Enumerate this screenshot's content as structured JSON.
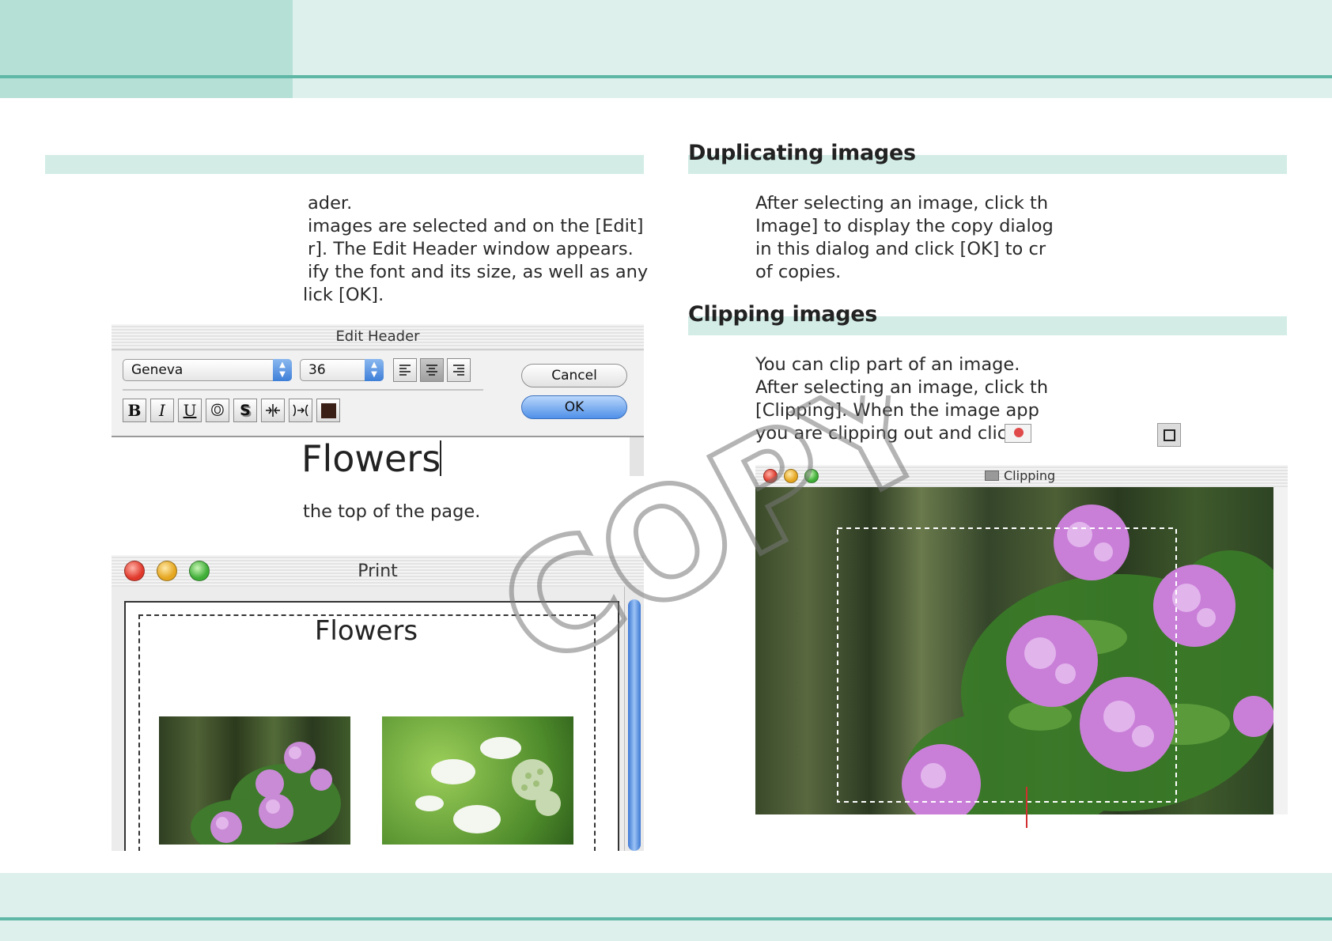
{
  "colors": {
    "band": "#ddf0ec",
    "band_tab": "#b4e0d6",
    "band_line": "#5fb7a6",
    "section_bar": "#d3ece6",
    "ok_button": "#4f90e8"
  },
  "left_column": {
    "instructions": [
      "ader.",
      " images are selected and on the [Edit]",
      "r]. The Edit Header window appears.",
      "ify the font and its size, as well as any",
      "lick [OK]."
    ],
    "edit_header_dialog": {
      "title": "Edit Header",
      "font_value": "Geneva",
      "size_value": "36",
      "cancel_label": "Cancel",
      "ok_label": "OK",
      "style_buttons": [
        "B",
        "I",
        "U",
        "O",
        "S",
        "condense",
        "expand",
        "color"
      ],
      "align_buttons": [
        "align-left",
        "align-center",
        "align-right"
      ],
      "header_text": "Flowers"
    },
    "result_text": "the top of the page.",
    "print_dialog": {
      "title": "Print",
      "page_header": "Flowers"
    }
  },
  "right_column": {
    "duplicating": {
      "heading": "Duplicating images",
      "lines": [
        "After selecting an image, click th",
        "Image] to display the copy dialog",
        "in this dialog and click [OK] to cr",
        "of copies."
      ]
    },
    "clipping": {
      "heading": "Clipping images",
      "lines": [
        "You can clip part of an image.",
        "After selecting an image, click th",
        "[Clipping]. When the image app",
        "you are clipping out and click"
      ],
      "window_title": "Clipping"
    }
  },
  "watermark": "COPY"
}
